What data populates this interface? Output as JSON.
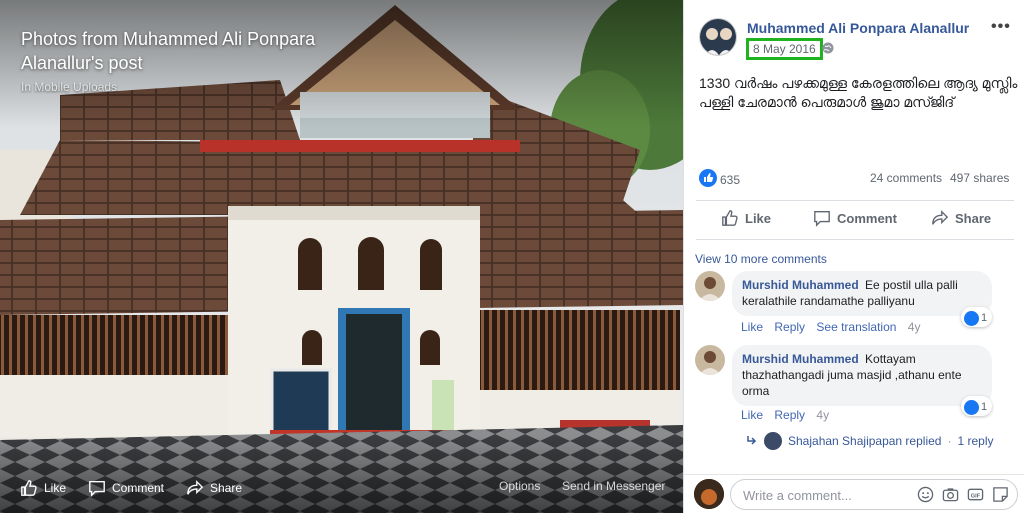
{
  "viewer": {
    "title": "Photos from Muhammed Ali Ponpara Alanallur's post",
    "album": "In Mobile Uploads",
    "like_label": "Like",
    "comment_label": "Comment",
    "share_label": "Share",
    "options_label": "Options",
    "messenger_label": "Send in Messenger"
  },
  "post": {
    "author": "Muhammed Ali Ponpara Alanallur",
    "date": "8 May 2016",
    "more_label": "•••",
    "text": "1330 വർഷം പഴക്കമുള്ള കേരളത്തിലെ ആദ്യ മുസ്ലിം പള്ളി ചേരമാൻ പെരുമാൾ ജുമാ മസ്ജിദ്",
    "likes": "635",
    "comments_count": "24 comments",
    "shares_count": "497 shares",
    "action_like": "Like",
    "action_comment": "Comment",
    "action_share": "Share"
  },
  "comments": {
    "view_more": "View 10 more comments",
    "items": [
      {
        "name": "Murshid Muhammed",
        "text": "Ee postil ulla palli keralathile randamathe palliyanu",
        "like": "Like",
        "reply": "Reply",
        "translate": "See translation",
        "age": "4y",
        "reactions": "1"
      },
      {
        "name": "Murshid Muhammed",
        "text": "Kottayam thazhathangadi juma masjid ,athanu ente orma",
        "like": "Like",
        "reply": "Reply",
        "age": "4y",
        "reactions": "1"
      }
    ],
    "reply_summary": {
      "replier": "Shajahan Shajipapan replied",
      "separator": "·",
      "count": "1 reply"
    }
  },
  "composer": {
    "placeholder": "Write a comment..."
  },
  "colors": {
    "link": "#365899",
    "highlight": "#1fb31f",
    "like_blue": "#1877f2"
  }
}
